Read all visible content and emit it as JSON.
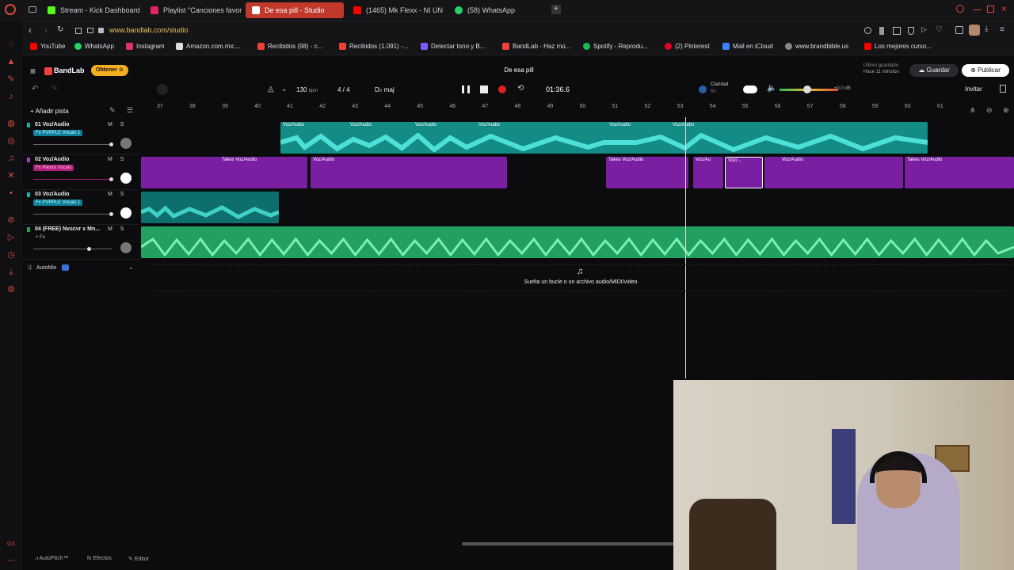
{
  "browser": {
    "tabs": [
      {
        "label": "Stream - Kick Dashboard",
        "color": "#53fc18"
      },
      {
        "label": "Playlist \"Canciones favor",
        "color": "#e0245e"
      },
      {
        "label": "De esa pill - Studio",
        "color": "#ffffff"
      },
      {
        "label": "(1465) Mk Flexx - NI UN",
        "color": "#ff0000"
      },
      {
        "label": "(58) WhatsApp",
        "color": "#25d366"
      }
    ],
    "url": "www.bandlab.com/studio",
    "bookmarks": [
      {
        "label": "YouTube",
        "color": "#ff0000"
      },
      {
        "label": "WhatsApp",
        "color": "#25d366"
      },
      {
        "label": "Instagram",
        "color": "#e1306c"
      },
      {
        "label": "Amazon.com.mx:...",
        "color": "#dddddd"
      },
      {
        "label": "Recibidos (98) - c...",
        "color": "#ea4335"
      },
      {
        "label": "Recibidos (1.091) -...",
        "color": "#ea4335"
      },
      {
        "label": "Detectar tono y B...",
        "color": "#7b5cff"
      },
      {
        "label": "BandLab - Haz mú...",
        "color": "#f04040"
      },
      {
        "label": "Spotify - Reprodu...",
        "color": "#1db954"
      },
      {
        "label": "(2) Pinterest",
        "color": "#e60023"
      },
      {
        "label": "Mail en iCloud",
        "color": "#3b82f6"
      },
      {
        "label": "www.brandbible.us",
        "color": "#888888"
      },
      {
        "label": "Los mejores curso...",
        "color": "#ff0000"
      }
    ]
  },
  "app": {
    "brand": "BandLab",
    "obtain_label": "Obtener",
    "project_title": "De esa pill",
    "last_saved_label": "Último guardado",
    "last_saved_time": "Hace 11 minutos",
    "save_label": "Guardar",
    "publish_label": "Publicar",
    "invite_label": "Invitar"
  },
  "transport": {
    "bpm": "130",
    "bpm_unit": "bpm",
    "time_signature": "4 / 4",
    "key": "D♭ maj",
    "time": "01:36.6",
    "clarity_label": "Claridad",
    "clarity_value": "50",
    "master_db": "+0.0 dB"
  },
  "add_track_label": "Añadir pista",
  "ruler": [
    "37",
    "38",
    "39",
    "40",
    "41",
    "42",
    "43",
    "44",
    "45",
    "46",
    "47",
    "48",
    "49",
    "50",
    "51",
    "52",
    "53",
    "54",
    "55",
    "56",
    "57",
    "58",
    "59",
    "60",
    "61"
  ],
  "tracks": [
    {
      "name": "01 Voz/Audio",
      "fx": "Fx PVRPLE Vocals 1",
      "fx_color": "#0f7e9a",
      "volume": 0.97,
      "clips": [
        {
          "label": "Voz/Audio"
        },
        {
          "label": "Voz/Audio"
        },
        {
          "label": "Voz/Audio"
        },
        {
          "label": "Voz/Audio"
        },
        {
          "label": "Voz/Audio"
        },
        {
          "label": "Voz/Audio"
        }
      ]
    },
    {
      "name": "02 Voz/Audio",
      "fx": "Fx Plexxx Vocals",
      "fx_color": "#b0207a",
      "volume": 0.97,
      "clips": [
        {
          "label": "Takes  Voz/Audio"
        },
        {
          "label": "Voz/Audio"
        },
        {
          "label": "Takes  Voz/Audio"
        },
        {
          "label": "Voz/Au"
        },
        {
          "label": "Voz/..."
        },
        {
          "label": "Voz/Audio"
        },
        {
          "label": "Takes  Voz/Audio"
        }
      ]
    },
    {
      "name": "03 Voz/Audio",
      "fx": "Fx PVRPLE Vocals 1",
      "fx_color": "#0f7e9a",
      "volume": 0.97,
      "clips": [
        {
          "label": ""
        }
      ]
    },
    {
      "name": "04 (FREE) Nvscvr x Mn...",
      "fx": "+ Fx",
      "fx_color": "transparent",
      "volume": 0.7,
      "clips": [
        {
          "label": ""
        }
      ]
    }
  ],
  "automix_label": "AutoMix",
  "drop_zone_text": "Suelta un bucle o un archivo audio/MIDI/video",
  "bottom": {
    "autopitch": "AutoPitch™",
    "effects": "Efectos",
    "editor": "Editor"
  },
  "colors": {
    "accent": "#f04040",
    "teal": "#138c86",
    "purple": "#7b1fa2",
    "green": "#21a061"
  }
}
